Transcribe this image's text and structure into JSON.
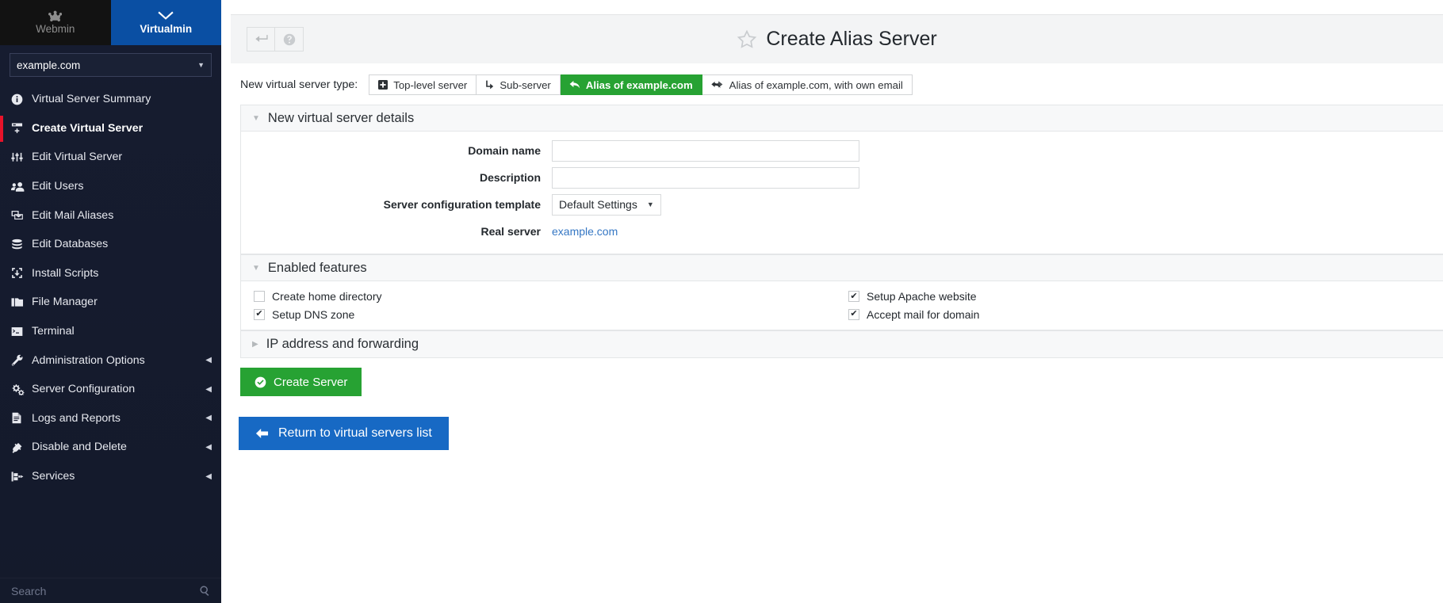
{
  "sidebar": {
    "brands": [
      {
        "label": "Webmin",
        "icon": "webmin-logo-icon",
        "active": false
      },
      {
        "label": "Virtualmin",
        "icon": "chevron-down-icon",
        "active": true
      }
    ],
    "domain_selector": {
      "value": "example.com",
      "icon": "chevron-down-icon"
    },
    "items": [
      {
        "label": "Virtual Server Summary",
        "icon": "info-circle-icon",
        "active": false,
        "expandable": false
      },
      {
        "label": "Create Virtual Server",
        "icon": "server-add-icon",
        "active": true,
        "expandable": false
      },
      {
        "label": "Edit Virtual Server",
        "icon": "sliders-icon",
        "active": false,
        "expandable": false
      },
      {
        "label": "Edit Users",
        "icon": "users-icon",
        "active": false,
        "expandable": false
      },
      {
        "label": "Edit Mail Aliases",
        "icon": "mail-aliases-icon",
        "active": false,
        "expandable": false
      },
      {
        "label": "Edit Databases",
        "icon": "database-icon",
        "active": false,
        "expandable": false
      },
      {
        "label": "Install Scripts",
        "icon": "download-box-icon",
        "active": false,
        "expandable": false
      },
      {
        "label": "File Manager",
        "icon": "folder-icon",
        "active": false,
        "expandable": false
      },
      {
        "label": "Terminal",
        "icon": "terminal-icon",
        "active": false,
        "expandable": false
      },
      {
        "label": "Administration Options",
        "icon": "wrench-icon",
        "active": false,
        "expandable": true
      },
      {
        "label": "Server Configuration",
        "icon": "gears-icon",
        "active": false,
        "expandable": true
      },
      {
        "label": "Logs and Reports",
        "icon": "file-text-icon",
        "active": false,
        "expandable": true
      },
      {
        "label": "Disable and Delete",
        "icon": "plug-icon",
        "active": false,
        "expandable": true
      },
      {
        "label": "Services",
        "icon": "services-icon",
        "active": false,
        "expandable": true
      }
    ],
    "search": {
      "label": "Search",
      "icon": "search-icon"
    }
  },
  "topbar": {
    "back_button": {
      "icon": "back-arrow-icon"
    },
    "help_button": {
      "icon": "question-circle-icon"
    },
    "star": {
      "icon": "star-outline-icon"
    },
    "title": "Create Alias Server"
  },
  "type_row": {
    "label": "New virtual server type:",
    "options": [
      {
        "label": "Top-level server",
        "icon": "plus-square-icon",
        "active": false
      },
      {
        "label": "Sub-server",
        "icon": "level-down-icon",
        "active": false
      },
      {
        "label": "Alias of example.com",
        "icon": "reply-icon",
        "active": true
      },
      {
        "label": "Alias of example.com, with own email",
        "icon": "reply-all-icon",
        "active": false
      }
    ]
  },
  "details_panel": {
    "title": "New virtual server details",
    "expanded": true,
    "fields": {
      "domain_name": {
        "label": "Domain name",
        "value": "",
        "placeholder": ""
      },
      "description": {
        "label": "Description",
        "value": "",
        "placeholder": ""
      },
      "template": {
        "label": "Server configuration template",
        "value": "Default Settings"
      },
      "real_server": {
        "label": "Real server",
        "value": "example.com"
      }
    }
  },
  "features_panel": {
    "title": "Enabled features",
    "expanded": true,
    "left": [
      {
        "label": "Create home directory",
        "checked": false
      },
      {
        "label": "Setup DNS zone",
        "checked": true
      }
    ],
    "right": [
      {
        "label": "Setup Apache website",
        "checked": true
      },
      {
        "label": "Accept mail for domain",
        "checked": true
      }
    ]
  },
  "ip_panel": {
    "title": "IP address and forwarding",
    "expanded": false
  },
  "actions": {
    "create": {
      "label": "Create Server",
      "icon": "check-circle-icon"
    },
    "return": {
      "label": "Return to virtual servers list",
      "icon": "arrow-left-icon"
    }
  },
  "colors": {
    "accent_green": "#27a233",
    "accent_blue": "#1769c4",
    "brand_blue": "#0a4fa3",
    "sidebar_bg": "#15192c",
    "active_marker": "#e8132a",
    "link": "#3577c4"
  }
}
